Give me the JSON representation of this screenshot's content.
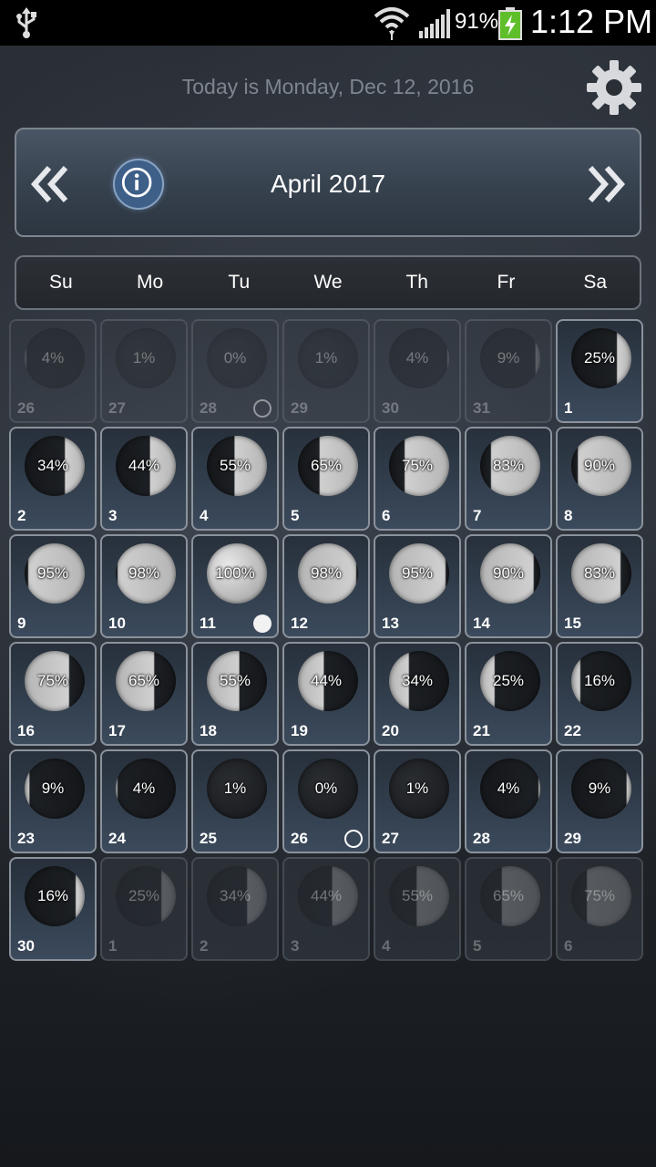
{
  "status_bar": {
    "battery_percent": "91%",
    "time": "1:12 PM",
    "icons": [
      "usb-icon",
      "wifi-icon",
      "signal-icon",
      "battery-charging-icon"
    ]
  },
  "header": {
    "today_label": "Today is Monday, Dec 12, 2016",
    "settings_icon": "gear-icon"
  },
  "month_nav": {
    "title": "April 2017",
    "prev_icon": "double-chevron-left-icon",
    "next_icon": "double-chevron-right-icon",
    "info_icon": "info-icon"
  },
  "weekdays": [
    "Su",
    "Mo",
    "Tu",
    "We",
    "Th",
    "Fr",
    "Sa"
  ],
  "days": [
    {
      "day": "26",
      "pct": "4%",
      "current": false,
      "waxing": false
    },
    {
      "day": "27",
      "pct": "1%",
      "current": false,
      "waxing": false
    },
    {
      "day": "28",
      "pct": "0%",
      "current": false,
      "waxing": false,
      "marker": "new"
    },
    {
      "day": "29",
      "pct": "1%",
      "current": false,
      "waxing": true
    },
    {
      "day": "30",
      "pct": "4%",
      "current": false,
      "waxing": true
    },
    {
      "day": "31",
      "pct": "9%",
      "current": false,
      "waxing": true
    },
    {
      "day": "1",
      "pct": "25%",
      "current": true,
      "waxing": true
    },
    {
      "day": "2",
      "pct": "34%",
      "current": true,
      "waxing": true
    },
    {
      "day": "3",
      "pct": "44%",
      "current": true,
      "waxing": true
    },
    {
      "day": "4",
      "pct": "55%",
      "current": true,
      "waxing": true
    },
    {
      "day": "5",
      "pct": "65%",
      "current": true,
      "waxing": true
    },
    {
      "day": "6",
      "pct": "75%",
      "current": true,
      "waxing": true
    },
    {
      "day": "7",
      "pct": "83%",
      "current": true,
      "waxing": true
    },
    {
      "day": "8",
      "pct": "90%",
      "current": true,
      "waxing": true
    },
    {
      "day": "9",
      "pct": "95%",
      "current": true,
      "waxing": true
    },
    {
      "day": "10",
      "pct": "98%",
      "current": true,
      "waxing": true
    },
    {
      "day": "11",
      "pct": "100%",
      "current": true,
      "waxing": true,
      "marker": "full"
    },
    {
      "day": "12",
      "pct": "98%",
      "current": true,
      "waxing": false
    },
    {
      "day": "13",
      "pct": "95%",
      "current": true,
      "waxing": false
    },
    {
      "day": "14",
      "pct": "90%",
      "current": true,
      "waxing": false
    },
    {
      "day": "15",
      "pct": "83%",
      "current": true,
      "waxing": false
    },
    {
      "day": "16",
      "pct": "75%",
      "current": true,
      "waxing": false
    },
    {
      "day": "17",
      "pct": "65%",
      "current": true,
      "waxing": false
    },
    {
      "day": "18",
      "pct": "55%",
      "current": true,
      "waxing": false
    },
    {
      "day": "19",
      "pct": "44%",
      "current": true,
      "waxing": false
    },
    {
      "day": "20",
      "pct": "34%",
      "current": true,
      "waxing": false
    },
    {
      "day": "21",
      "pct": "25%",
      "current": true,
      "waxing": false
    },
    {
      "day": "22",
      "pct": "16%",
      "current": true,
      "waxing": false
    },
    {
      "day": "23",
      "pct": "9%",
      "current": true,
      "waxing": false
    },
    {
      "day": "24",
      "pct": "4%",
      "current": true,
      "waxing": false
    },
    {
      "day": "25",
      "pct": "1%",
      "current": true,
      "waxing": false
    },
    {
      "day": "26",
      "pct": "0%",
      "current": true,
      "waxing": false,
      "marker": "new"
    },
    {
      "day": "27",
      "pct": "1%",
      "current": true,
      "waxing": true
    },
    {
      "day": "28",
      "pct": "4%",
      "current": true,
      "waxing": true
    },
    {
      "day": "29",
      "pct": "9%",
      "current": true,
      "waxing": true
    },
    {
      "day": "30",
      "pct": "16%",
      "current": true,
      "waxing": true
    },
    {
      "day": "1",
      "pct": "25%",
      "current": false,
      "waxing": true
    },
    {
      "day": "2",
      "pct": "34%",
      "current": false,
      "waxing": true
    },
    {
      "day": "3",
      "pct": "44%",
      "current": false,
      "waxing": true
    },
    {
      "day": "4",
      "pct": "55%",
      "current": false,
      "waxing": true
    },
    {
      "day": "5",
      "pct": "65%",
      "current": false,
      "waxing": true
    },
    {
      "day": "6",
      "pct": "75%",
      "current": false,
      "waxing": true
    }
  ]
}
